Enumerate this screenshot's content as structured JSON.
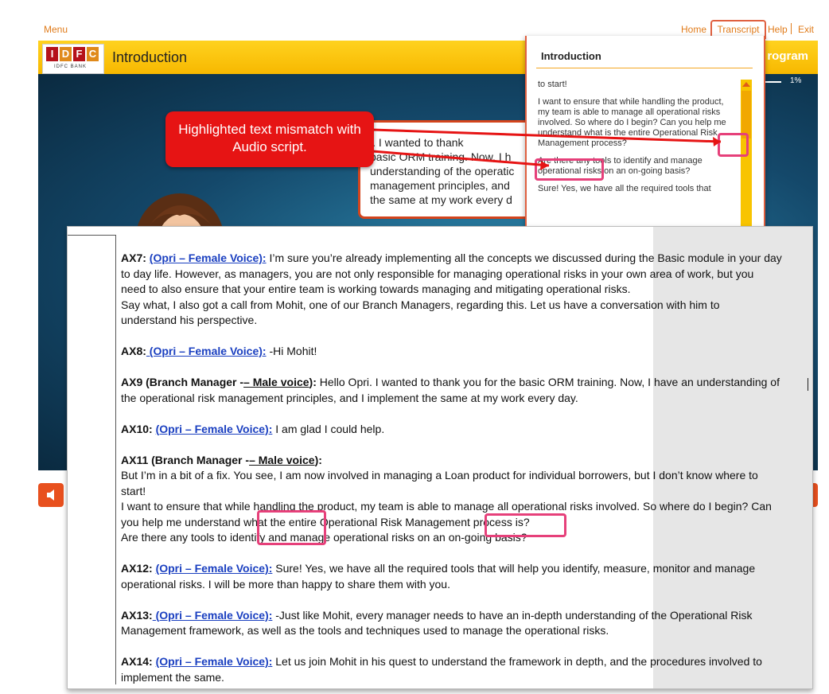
{
  "nav": {
    "menu": "Menu",
    "home": "Home",
    "transcript": "Transcript",
    "help": "Help",
    "exit": "Exit"
  },
  "header": {
    "logo_letters": [
      "I",
      "D",
      "F",
      "C"
    ],
    "logo_sub": "IDFC BANK",
    "title": "Introduction",
    "program_label": "rogram",
    "progress_text": "1%"
  },
  "speech_bubble": {
    "text": "i. I wanted to thank\nbasic ORM training. Now, I h\nunderstanding of the operatic\nmanagement principles, and\nthe same at my work every d"
  },
  "transcript_panel": {
    "title": "Introduction",
    "paragraphs": [
      "to start!",
      "I want to ensure that while handling the product, my team is able to manage all operational risks involved. So where do I begin? Can you help me understand what is the entire Operational Risk Management process?",
      "Are there any tools to identify and manage operational risks on an on-going basis?",
      "Sure! Yes, we have all the required tools that"
    ]
  },
  "annotation": {
    "text": "Highlighted text mismatch with Audio script."
  },
  "doc": {
    "paragraphs": [
      {
        "speaker": "AX7:",
        "voice": "(Opri – Female Voice):",
        "lines": [
          " I’m sure you’re already implementing all the concepts we discussed during the Basic module in your day",
          "to day life. However, as managers, you are not only responsible for managing operational risks in your own area of work, but you",
          "need to also ensure that your entire team is working towards managing and mitigating operational risks.",
          "Say what, I also got a call from Mohit, one of our Branch Managers, regarding this. Let us have a conversation with him to",
          "understand his perspective."
        ]
      },
      {
        "speaker": "AX8:",
        "voice": " (Opri – Female Voice):",
        "lines": [
          " -Hi Mohit!"
        ]
      },
      {
        "speaker": "AX9 (Branch Manager -",
        "voice": "– Male voice",
        "speaker_end": "):",
        "lines": [
          " Hello Opri. I wanted to thank you for the basic ORM training. Now, I have an understanding of",
          "the operational risk management principles, and I implement the same at my work every day."
        ]
      },
      {
        "speaker": "AX10:",
        "voice": "(Opri – Female Voice):",
        "lines": [
          " I am glad I could help."
        ]
      },
      {
        "speaker": "AX11 (Branch Manager -",
        "voice": "– Male voice",
        "speaker_end": "):",
        "lines": [
          "",
          "But I’m in a bit of a fix. You see, I am now involved in managing a Loan product for individual borrowers, but I don’t know where to",
          "start!",
          "I want to ensure that while handling the product, my team is able to manage all operational risks involved. So where do I begin? Can",
          "you help me understand  what the entire Operational Risk Management process is?",
          "Are there any tools to identify and manage operational risks on an on-going basis?"
        ]
      },
      {
        "speaker": "AX12:",
        "voice": "(Opri – Female Voice):",
        "lines": [
          " Sure! Yes, we have all the required tools that will help you identify, measure, monitor and manage",
          "operational risks. I will be more than happy to share them with you."
        ]
      },
      {
        "speaker": "AX13:",
        "voice": " (Opri – Female Voice):",
        "lines": [
          " -Just like Mohit, every manager needs to have an in-depth understanding of the Operational Risk",
          "Management framework, as well as the tools and techniques used to manage the operational risks."
        ]
      },
      {
        "speaker": "AX14:",
        "voice": "(Opri – Female Voice):",
        "lines": [
          " Let us join Mohit in his quest to understand the framework in depth, and the procedures involved to",
          "implement the same."
        ]
      }
    ]
  },
  "colors": {
    "accent_orange": "#e07b1a",
    "header_yellow": "#ffd21f",
    "annotation_red": "#e61414",
    "highlight_pink": "#e6407a",
    "voice_blue": "#1a3fc0"
  }
}
